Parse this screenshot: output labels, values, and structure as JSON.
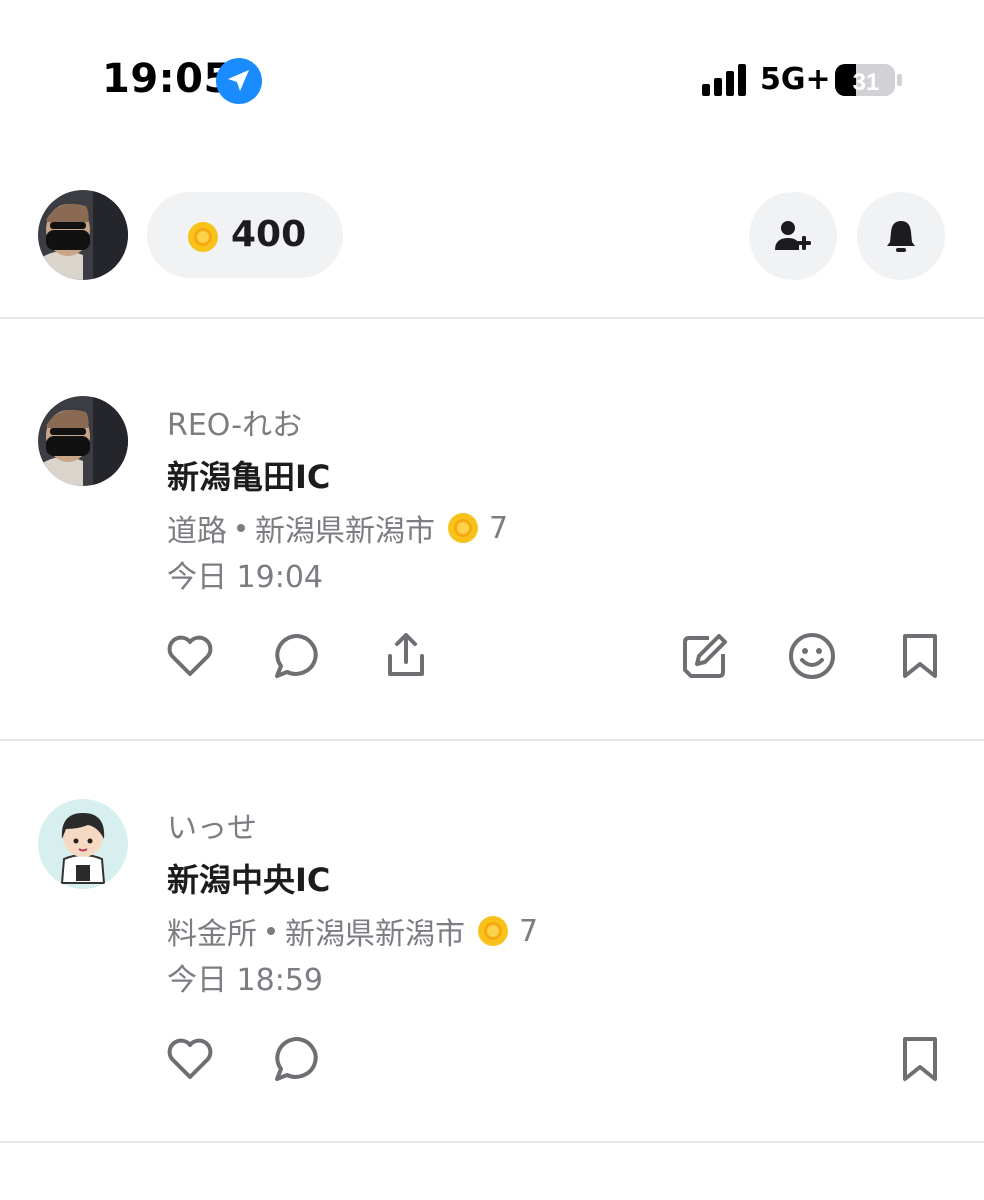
{
  "status_bar": {
    "time": "19:05",
    "network": "5G+",
    "battery": "31",
    "icons": [
      "location-arrow-icon",
      "signal-icon",
      "battery-icon"
    ]
  },
  "header": {
    "coin_count": "400",
    "icons": [
      "coin-icon",
      "add-friend-icon",
      "bell-icon"
    ]
  },
  "posts": [
    {
      "username": "REO-れお",
      "title": "新潟亀田IC",
      "category": "道路",
      "location": "新潟県新潟市",
      "coins": "7",
      "time": "今日 19:04",
      "actions": [
        "heart-icon",
        "comment-icon",
        "share-icon",
        "edit-icon",
        "emoji-icon",
        "bookmark-icon"
      ]
    },
    {
      "username": "いっせ",
      "title": "新潟中央IC",
      "category": "料金所",
      "location": "新潟県新潟市",
      "coins": "7",
      "time": "今日 18:59",
      "actions": [
        "heart-icon",
        "comment-icon",
        "bookmark-icon"
      ]
    }
  ],
  "colors": {
    "accent_blue": "#1a8cff",
    "coin_gold": "#f7c31b",
    "icon_gray": "#6e6e73",
    "pill_bg": "#f1f2f4"
  }
}
